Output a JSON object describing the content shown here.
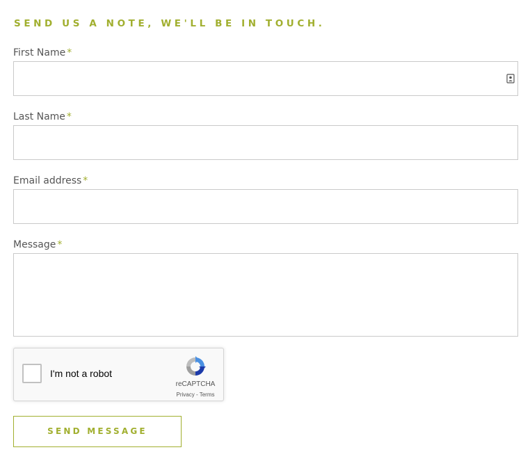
{
  "heading": "SEND US A NOTE, WE'LL BE IN TOUCH.",
  "required_marker": "*",
  "fields": {
    "first_name": {
      "label": "First Name",
      "value": "",
      "placeholder": ""
    },
    "last_name": {
      "label": "Last Name",
      "value": "",
      "placeholder": ""
    },
    "email": {
      "label": "Email address",
      "value": "",
      "placeholder": ""
    },
    "message": {
      "label": "Message",
      "value": "",
      "placeholder": ""
    }
  },
  "captcha": {
    "checkbox_label": "I'm not a robot",
    "brand": "reCAPTCHA",
    "links": "Privacy - Terms",
    "checked": false
  },
  "submit_label": "SEND MESSAGE",
  "colors": {
    "accent": "#a1af2f",
    "label": "#555555",
    "border": "#c9c9c9"
  },
  "icons": {
    "first_name_field": "contact-card-icon",
    "captcha": "recaptcha-logo-icon"
  }
}
